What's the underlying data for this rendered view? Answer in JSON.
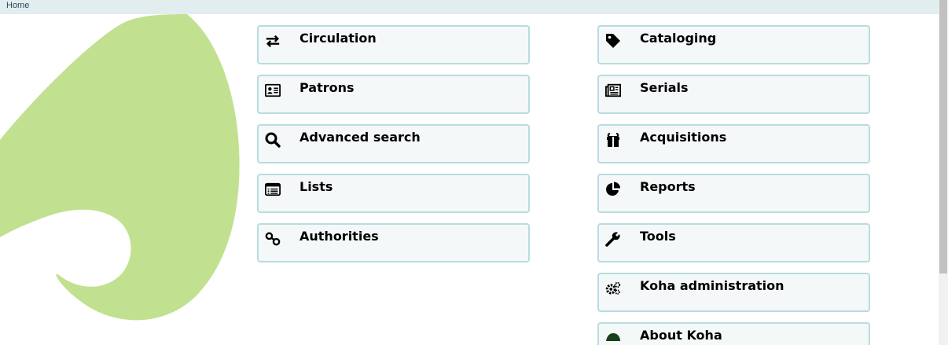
{
  "breadcrumb": {
    "home": "Home"
  },
  "modules_left": [
    {
      "label": "Circulation",
      "icon": "arrows-exchange-icon"
    },
    {
      "label": "Patrons",
      "icon": "id-card-icon"
    },
    {
      "label": "Advanced search",
      "icon": "search-icon"
    },
    {
      "label": "Lists",
      "icon": "list-icon"
    },
    {
      "label": "Authorities",
      "icon": "link-icon"
    }
  ],
  "modules_right": [
    {
      "label": "Cataloging",
      "icon": "tag-icon"
    },
    {
      "label": "Serials",
      "icon": "newspaper-icon"
    },
    {
      "label": "Acquisitions",
      "icon": "gift-icon"
    },
    {
      "label": "Reports",
      "icon": "pie-chart-icon"
    },
    {
      "label": "Tools",
      "icon": "wrench-icon"
    },
    {
      "label": "Koha administration",
      "icon": "gears-icon"
    },
    {
      "label": "About Koha",
      "icon": "koha-leaf-icon"
    }
  ],
  "colors": {
    "tile_bg": "#f4f8f9",
    "tile_border": "#b9dcdf",
    "leaf": "#c1e190",
    "breadcrumb_bg": "#e1edef"
  }
}
